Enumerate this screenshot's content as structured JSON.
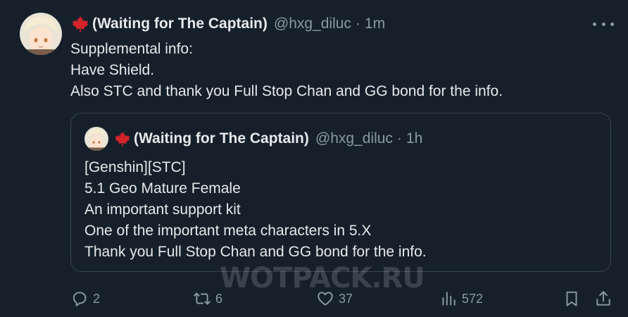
{
  "tweet": {
    "display_name": "(Waiting for The Captain)",
    "handle": "@hxg_diluc",
    "separator": "·",
    "time": "1m",
    "lines": [
      "Supplemental info:",
      "Have Shield.",
      "Also STC and thank you Full Stop Chan and GG bond for the info."
    ]
  },
  "quoted": {
    "display_name": "(Waiting for The Captain)",
    "handle": "@hxg_diluc",
    "separator": "·",
    "time": "1h",
    "lines": [
      "[Genshin][STC]",
      "5.1 Geo Mature Female",
      "An important support kit",
      "One of the important meta characters in 5.X",
      "Thank you Full Stop Chan and GG bond for the info."
    ]
  },
  "actions": {
    "replies": "2",
    "retweets": "6",
    "likes": "37",
    "views": "572"
  },
  "icons": {
    "more": "more-icon",
    "reply": "reply-icon",
    "retweet": "retweet-icon",
    "like": "heart-icon",
    "views": "views-icon",
    "bookmark": "bookmark-icon",
    "share": "share-icon",
    "flag": "maple-leaf-icon"
  },
  "watermark": "WOTPACK.RU",
  "colors": {
    "background": "#15202b",
    "text": "#e7e9ea",
    "secondary": "#8b98a5",
    "border": "#38444d",
    "maple": "#d5232a"
  }
}
